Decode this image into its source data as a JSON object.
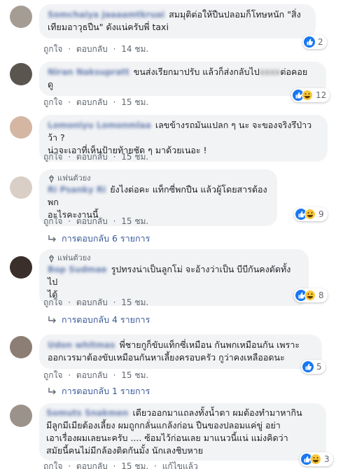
{
  "meta_labels": {
    "like": "ถูกใจ",
    "reply": "ตอบกลับ",
    "dot": "·"
  },
  "fan_label": "แฟนตัวยง",
  "comments": [
    {
      "author": "Somchaiya Jaaaamtkruai",
      "text_lines": [
        "สมมุติต่อให้ปืนปลอมก็โทษหนัก \"สิ่ง",
        "เทียมอาวุธปืน\" ดังแน่ครับพี่ taxi"
      ],
      "time": "14 ชม.",
      "react_count": "2",
      "reactions": [
        "like"
      ]
    },
    {
      "author": "Niran Naksupratt",
      "text_lines": [
        "ขนส่งเรียกมาปรับ แล้วก็ส่งกลับไป",
        "ต่อคอย",
        "ดู"
      ],
      "time": "15 ชม.",
      "react_count": "12",
      "reactions": [
        "like",
        "haha"
      ]
    },
    {
      "author": "Lomoniyu Lomonmlaa",
      "text_lines": [
        "เลขข้างรถมันแปลก ๆ นะ จะของจริงรึป่าวว้า ?",
        "น่าจะเอาที่เห็นป้ายท้ายชัด ๆ มาด้วยเนอะ !"
      ],
      "time": "15 ชม.",
      "react_count": "",
      "reactions": []
    },
    {
      "fan": true,
      "author": "Ri Psanky Ri",
      "text_lines": [
        "ยังไงต่อคะ แท็กซี่พกปืน แล้วผู้โดยสารต้องพก",
        "อะไรคะงานนี้"
      ],
      "time": "15 ชม.",
      "react_count": "9",
      "reactions": [
        "like",
        "haha"
      ],
      "replies": "การตอบกลับ 6 รายการ"
    },
    {
      "fan": true,
      "author": "Bop Sudmae",
      "text_lines": [
        "รูปทรงน่าเป็นลูกโม่ จะอ้างว่าเป็น บีบีกันคงดัดทั้งไป",
        "ได้"
      ],
      "time": "15 ชม.",
      "react_count": "8",
      "reactions": [
        "like",
        "haha"
      ],
      "replies": "การตอบกลับ 4 รายการ"
    },
    {
      "author": "Udon whitmas",
      "text_lines": [
        "พี่ชายกูก็ขับแท็กซี่เหมือน กันพกเหมือนกัน เพราะ",
        "ออกเวรมาต้องขับเหมือนกันหาเลี้ยงครอบครัว กูว่าคงเหลืออดนะ"
      ],
      "time": "15 ชม.",
      "react_count": "5",
      "reactions": [
        "like"
      ],
      "replies": "การตอบกลับ 1 รายการ"
    },
    {
      "author": "Somuts Snakmen",
      "text_lines": [
        "เดียวออกมาแถลงทั้งน้ำตา ผมต้องทำมาหากิน",
        "มีลูกมีเมียต้องเลี้ยง ผมถูกกลั่นแกล้งก่อน ปืนของปลอมแค่ขู่ อย่า",
        "เอาเรื่องผมเลยนะครับ .... ซ้อมไว้ก่อนเลย มาแนวนี้แน่ แม่งคิดว่า",
        "สมัยนี้คนไม่มีกล้องติดกันมั้ง นักเลงชิบหาย"
      ],
      "time": "15 ชม.",
      "edited": "แก้ไขแล้ว",
      "react_count": "3",
      "reactions": [
        "like",
        "haha"
      ]
    }
  ]
}
